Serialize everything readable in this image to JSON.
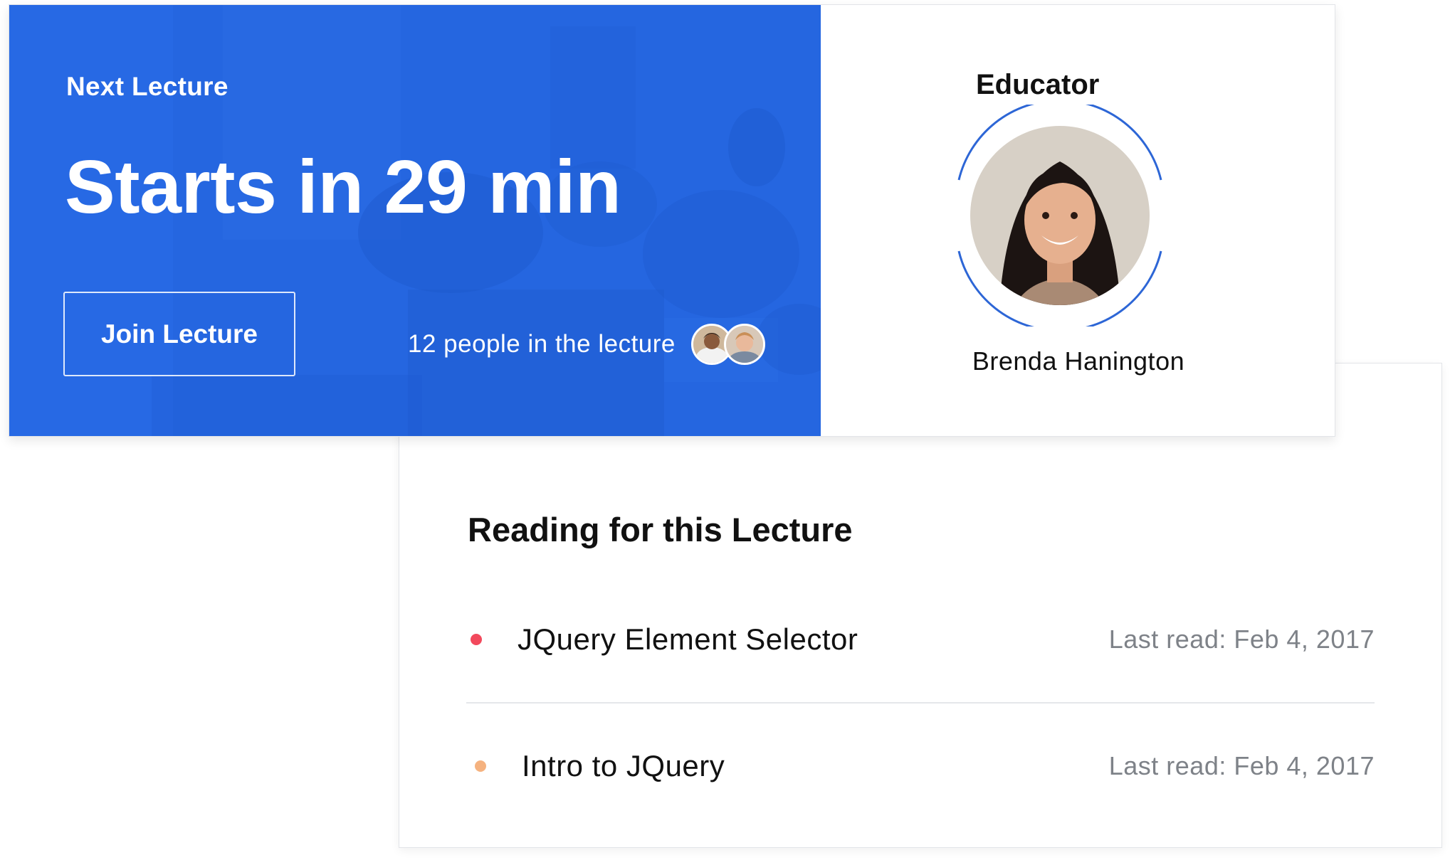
{
  "lecture": {
    "eyebrow": "Next Lecture",
    "title": "Starts in 29 min",
    "join_label": "Join Lecture",
    "attendees_text": "12 people in the lecture",
    "attendee_avatars": [
      "attendee-avatar-1",
      "attendee-avatar-2"
    ],
    "background_color": "#2566e0"
  },
  "educator": {
    "heading": "Educator",
    "name": "Brenda Hanington",
    "ring_color": "#2d66d6"
  },
  "reading": {
    "title": "Reading for this Lecture",
    "items": [
      {
        "title": "JQuery Element Selector",
        "meta": "Last read: Feb 4, 2017",
        "dot_color": "#f2495c"
      },
      {
        "title": "Intro to JQuery",
        "meta": "Last read: Feb 4, 2017",
        "dot_color": "#f5b27f"
      }
    ]
  }
}
